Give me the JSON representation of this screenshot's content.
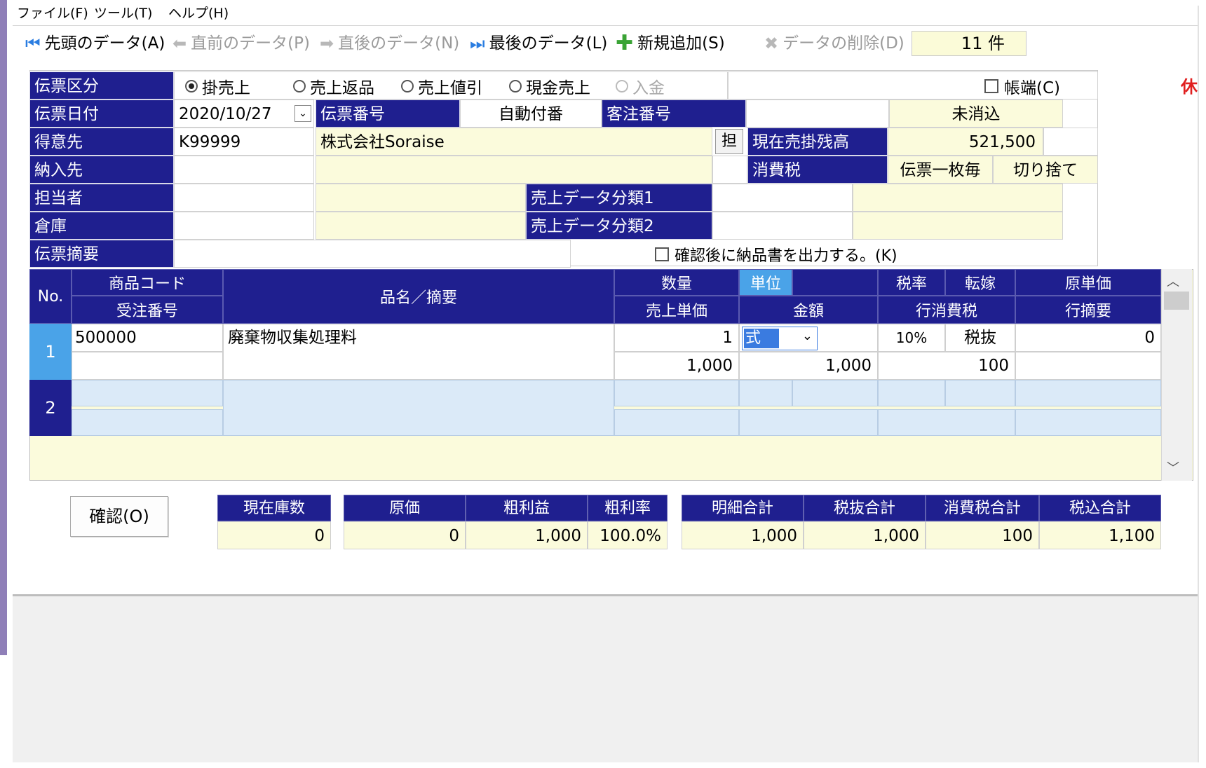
{
  "menu": [
    "ファイル(F)",
    "ツール(T)",
    "ヘルプ(H)"
  ],
  "toolbar": {
    "first": "先頭のデータ(A)",
    "prev": "直前のデータ(P)",
    "next": "直後のデータ(N)",
    "last": "最後のデータ(L)",
    "add": "新規追加(S)",
    "delete": "データの削除(D)",
    "count": "11 件"
  },
  "header": {
    "slip_type_label": "伝票区分",
    "radios": [
      "掛売上",
      "売上返品",
      "売上値引",
      "現金売上",
      "入金"
    ],
    "selected_radio": "掛売上",
    "book_end_label": "帳端(C)",
    "slip_date_label": "伝票日付",
    "slip_date": "2020/10/27",
    "slip_no_label": "伝票番号",
    "slip_no": "自動付番",
    "order_no_label": "客注番号",
    "uncleared": "未消込",
    "customer_label": "得意先",
    "customer_code": "K99999",
    "customer_name": "株式会社Soraise",
    "tan_button": "担",
    "balance_label": "現在売掛残高",
    "balance": "521,500",
    "delivery_label": "納入先",
    "tax_label": "消費税",
    "tax_method": "伝票一枚毎",
    "tax_rounding": "切り捨て",
    "staff_label": "担当者",
    "class1_label": "売上データ分類1",
    "warehouse_label": "倉庫",
    "class2_label": "売上データ分類2",
    "summary_label": "伝票摘要",
    "print_check_label": "確認後に納品書を出力する。(K)",
    "side_text": "休"
  },
  "grid": {
    "headers": {
      "no": "No.",
      "product_code": "商品コード",
      "order_no": "受注番号",
      "name": "品名／摘要",
      "qty": "数量",
      "unit": "単位",
      "price": "売上単価",
      "amount": "金額",
      "tax_rate": "税率",
      "transfer": "転嫁",
      "line_tax": "行消費税",
      "cost": "原単価",
      "line_note": "行摘要"
    },
    "rows": [
      {
        "no": "1",
        "product_code": "500000",
        "order_no": "",
        "name": "廃棄物収集処理料",
        "qty": "1",
        "unit": "式",
        "price": "1,000",
        "amount": "1,000",
        "tax_rate": "10%",
        "transfer": "税抜",
        "line_tax": "100",
        "cost": "0",
        "line_note": ""
      },
      {
        "no": "2"
      }
    ]
  },
  "footer": {
    "confirm_button": "確認(O)",
    "stock_label": "現在庫数",
    "stock": "0",
    "cost_label": "原価",
    "cost": "0",
    "profit_label": "粗利益",
    "profit": "1,000",
    "margin_label": "粗利率",
    "margin": "100.0%",
    "detail_total_label": "明細合計",
    "detail_total": "1,000",
    "pretax_label": "税抜合計",
    "pretax": "1,000",
    "tax_total_label": "消費税合計",
    "tax_total": "100",
    "total_label": "税込合計",
    "total": "1,100"
  },
  "colors": {
    "header_bg": "#1f1f8f",
    "readonly_bg": "#fbfbdc",
    "selected_row_bg": "#4aa3e8",
    "empty_row_bg": "#dbeaf8"
  }
}
